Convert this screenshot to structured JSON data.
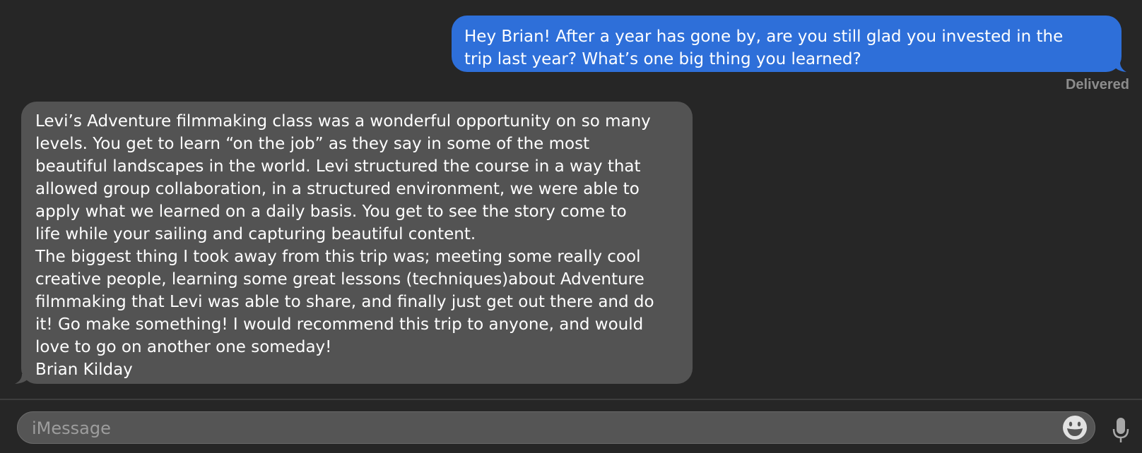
{
  "conversation": {
    "outgoing_message": "Hey Brian! After a year has gone by, are you still glad you invested in the\ntrip last year? What’s one big thing you learned?",
    "status": "Delivered",
    "incoming_message": "Levi’s Adventure filmmaking class was a wonderful opportunity on so many\nlevels. You get to learn “on the job” as they say in some of the most\nbeautiful landscapes in the world. Levi structured the course in a way that\nallowed group collaboration, in a structured environment,  we were able to\napply what we learned on a daily basis. You get to see the story come to\nlife while your sailing and capturing beautiful content.\nThe biggest thing I took away from this trip was; meeting some really cool\ncreative people, learning some great lessons (techniques)about Adventure\nfilmmaking that Levi was able to share, and finally just get out there and do\nit! Go make something! I would recommend this trip to anyone, and would\nlove to go on another one someday!\nBrian Kilday"
  },
  "compose": {
    "placeholder": "iMessage",
    "value": ""
  },
  "icons": {
    "emoji": "emoji-icon",
    "mic": "microphone-icon"
  },
  "colors": {
    "background": "#262626",
    "outgoing_bubble": "#2e6fd9",
    "incoming_bubble": "#535353",
    "status_text": "#8c8c8c"
  }
}
